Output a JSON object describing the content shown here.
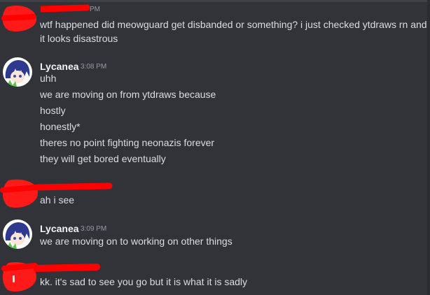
{
  "messages": [
    {
      "author": "",
      "time": "PM",
      "redacted": true,
      "lines": [
        "wtf happened did meowguard get disbanded or something? i just checked ytdraws rn and",
        "it looks disastrous"
      ]
    },
    {
      "author": "Lycanea",
      "time": "3:08 PM",
      "redacted": false,
      "lines": [
        "uhh",
        "we are moving on from ytdraws because",
        "hostly",
        "honestly*",
        "theres no point fighting neonazis forever",
        "they will get bored eventually"
      ]
    },
    {
      "author": "",
      "time": "",
      "redacted": true,
      "lines": [
        "ah i see"
      ]
    },
    {
      "author": "Lycanea",
      "time": "3:09 PM",
      "redacted": false,
      "lines": [
        "we are moving on to working on other things"
      ]
    },
    {
      "author": "",
      "time": "",
      "redacted": true,
      "lines": [
        "kk. it's sad to see you go but it is what it is sadly"
      ]
    }
  ],
  "colors": {
    "background": "#313338",
    "text": "#dbdee1",
    "username": "#f2f3f5",
    "timestamp": "#949ba4",
    "redaction": "#ff0000"
  },
  "icons": {
    "avatar_lycanea": "anime-avatar-icon",
    "redaction_mark": "red-scribble"
  }
}
